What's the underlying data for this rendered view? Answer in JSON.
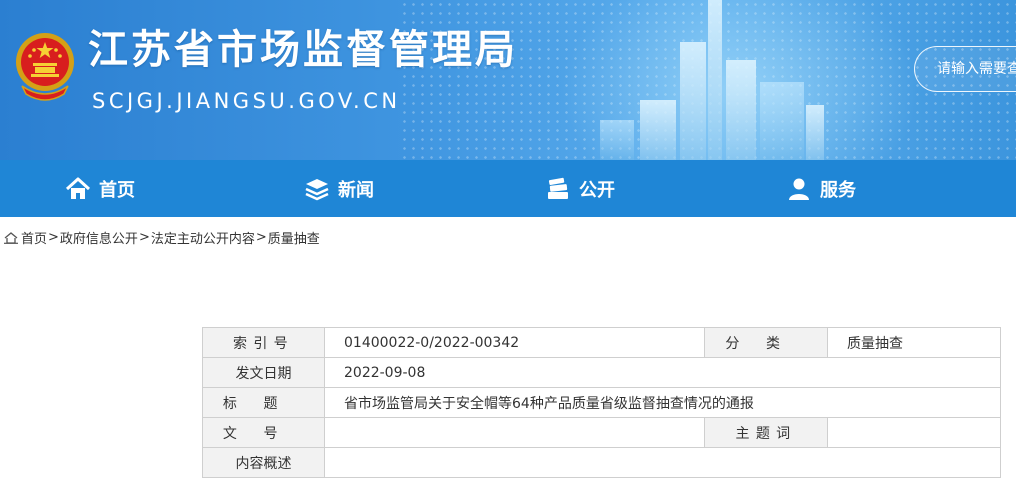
{
  "header": {
    "title": "江苏省市场监督管理局",
    "domain": "SCJGJ.JIANGSU.GOV.CN",
    "search_placeholder": "请输入需要查询的内容"
  },
  "nav": {
    "items": [
      {
        "label": "首页",
        "icon": "home-icon"
      },
      {
        "label": "新闻",
        "icon": "layers-icon"
      },
      {
        "label": "公开",
        "icon": "books-icon"
      },
      {
        "label": "服务",
        "icon": "user-icon"
      }
    ]
  },
  "breadcrumb": {
    "icon": "home-small-icon",
    "items": [
      "首页",
      "政府信息公开",
      "法定主动公开内容",
      "质量抽查"
    ],
    "separator": ">"
  },
  "info": {
    "index_label": "索引号",
    "index_value": "01400022-0/2022-00342",
    "category_label": "分类",
    "category_value": "质量抽查",
    "date_label": "发文日期",
    "date_value": "2022-09-08",
    "title_label": "标题",
    "title_value": "省市场监管局关于安全帽等64种产品质量省级监督抽查情况的通报",
    "docno_label": "文号",
    "docno_value": "",
    "keywords_label": "主题词",
    "keywords_value": "",
    "summary_label": "内容概述",
    "summary_value": ""
  },
  "colors": {
    "nav_bg": "#1f86d6",
    "header_bg": "#3f95e0",
    "label_bg": "#f2f2f2"
  }
}
